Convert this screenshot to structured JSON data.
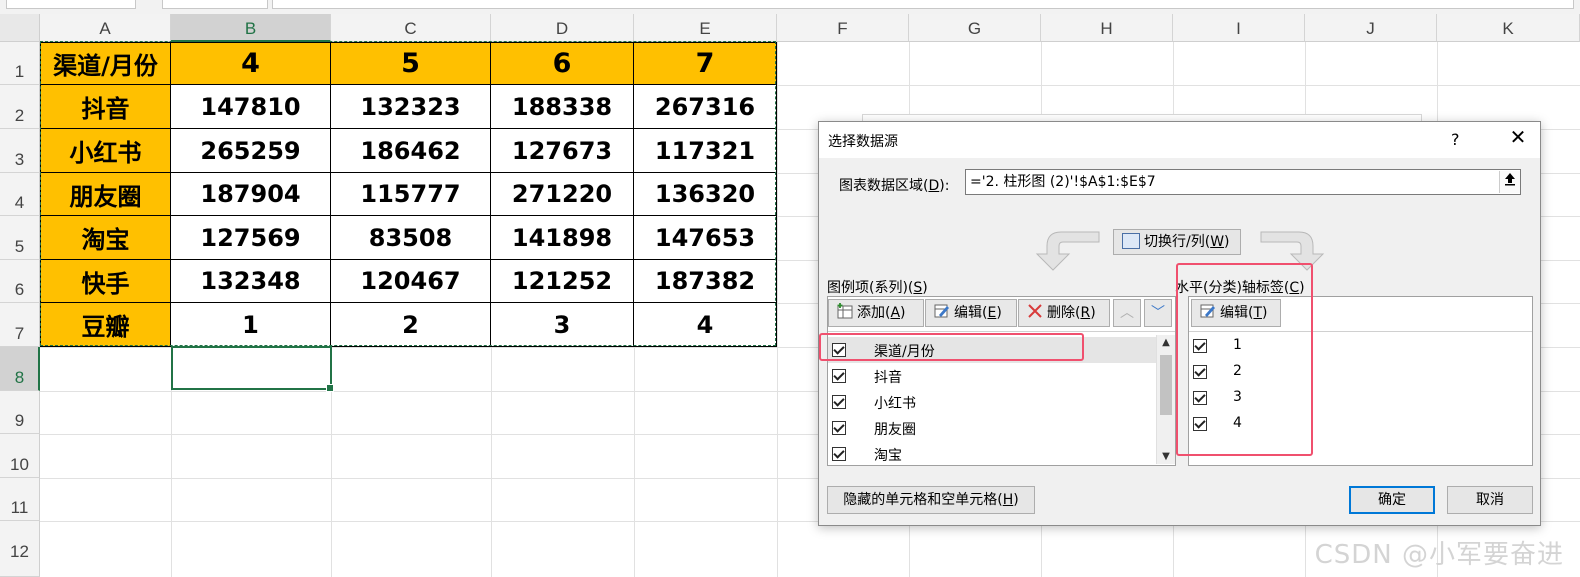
{
  "sheet": {
    "columns": [
      "A",
      "B",
      "C",
      "D",
      "E",
      "F",
      "G",
      "H",
      "I",
      "J",
      "K"
    ],
    "rows": [
      "1",
      "2",
      "3",
      "4",
      "5",
      "6",
      "7",
      "8",
      "9",
      "10",
      "11",
      "12"
    ],
    "table": [
      [
        "渠道/月份",
        "4",
        "5",
        "6",
        "7"
      ],
      [
        "抖音",
        "147810",
        "132323",
        "188338",
        "267316"
      ],
      [
        "小红书",
        "265259",
        "186462",
        "127673",
        "117321"
      ],
      [
        "朋友圈",
        "187904",
        "115777",
        "271220",
        "136320"
      ],
      [
        "淘宝",
        "127569",
        "83508",
        "141898",
        "147653"
      ],
      [
        "快手",
        "132348",
        "120467",
        "121252",
        "187382"
      ],
      [
        "豆瓣",
        "1",
        "2",
        "3",
        "4"
      ]
    ],
    "header_color": "#ffc000",
    "selection_color": "#217346"
  },
  "dialog": {
    "title": "选择数据源",
    "help": "?",
    "close": "✕",
    "range_label_prefix": "图表数据区域(",
    "range_label_key": "D",
    "range_label_suffix": "):",
    "range_value": "='2. 柱形图 (2)'!$A$1:$E$7",
    "switch_prefix": "切换行/列(",
    "switch_key": "W",
    "switch_suffix": ")",
    "legend_label_prefix": "图例项(系列)(",
    "legend_label_key": "S",
    "legend_label_suffix": ")",
    "add_prefix": "添加(",
    "add_key": "A",
    "add_suffix": ")",
    "edit_prefix": "编辑(",
    "edit_key": "E",
    "edit_suffix": ")",
    "delete_prefix": "删除(",
    "delete_key": "R",
    "delete_suffix": ")",
    "series": [
      "渠道/月份",
      "抖音",
      "小红书",
      "朋友圈",
      "淘宝"
    ],
    "axis_label_prefix": "水平(分类)轴标签(",
    "axis_label_key": "C",
    "axis_label_suffix": ")",
    "axis_edit_prefix": "编辑(",
    "axis_edit_key": "T",
    "axis_edit_suffix": ")",
    "categories": [
      "1",
      "2",
      "3",
      "4"
    ],
    "hidden_cells_prefix": "隐藏的单元格和空单元格(",
    "hidden_cells_key": "H",
    "hidden_cells_suffix": ")",
    "ok": "确定",
    "cancel": "取消",
    "highlight_color": "#f0506e"
  },
  "watermark": "CSDN @小军要奋进"
}
